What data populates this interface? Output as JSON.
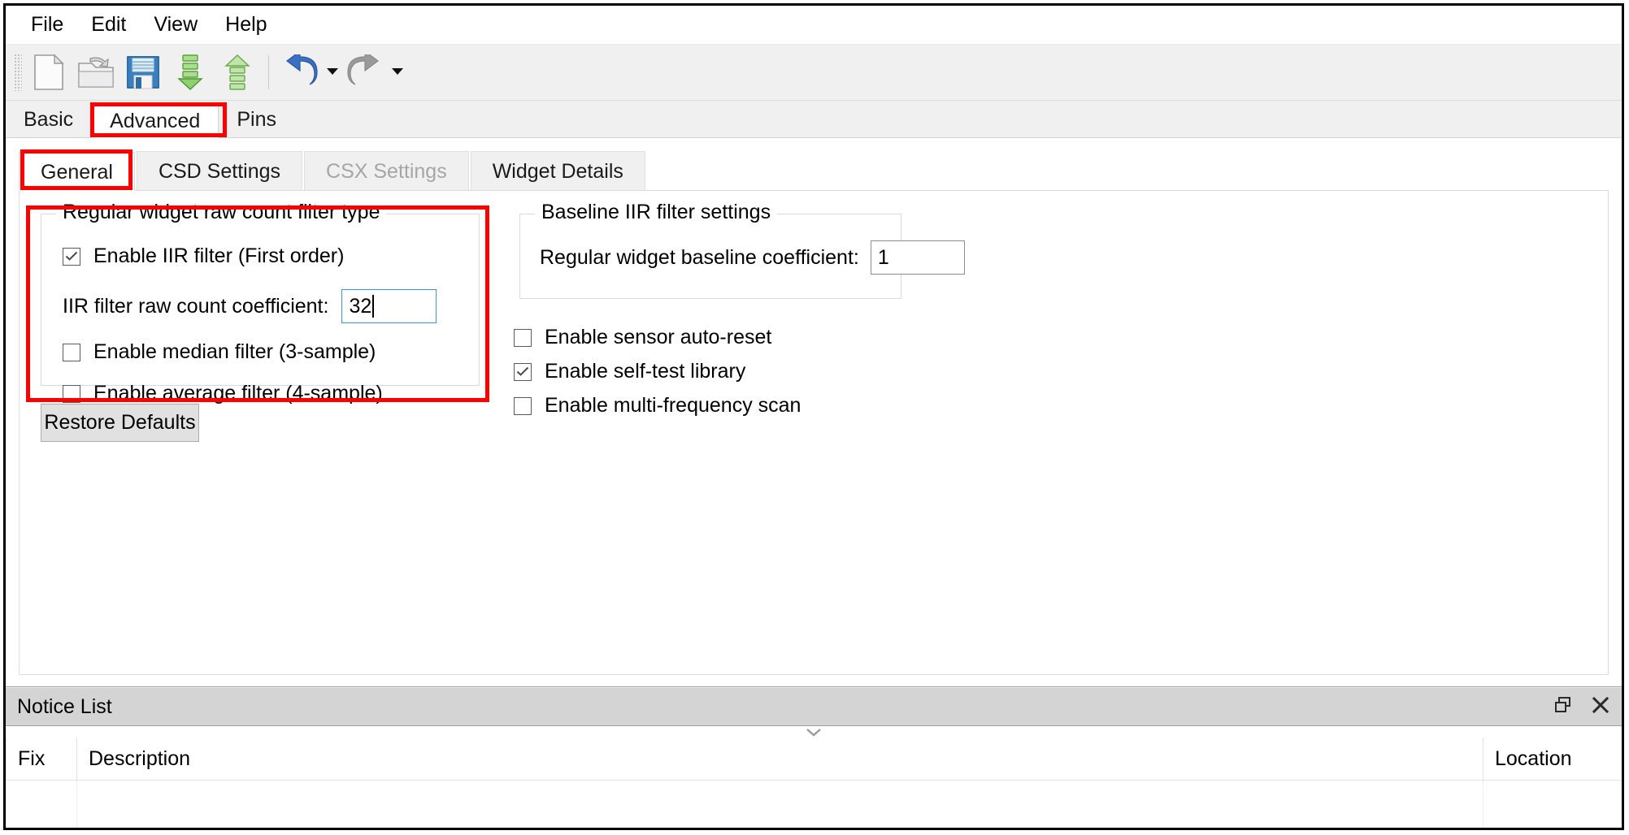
{
  "menu": {
    "items": [
      {
        "label": "File"
      },
      {
        "label": "Edit"
      },
      {
        "label": "View"
      },
      {
        "label": "Help"
      }
    ]
  },
  "toolbar": {
    "buttons": [
      {
        "name": "new-file-icon",
        "tooltip": "New",
        "enabled": true
      },
      {
        "name": "open-folder-icon",
        "tooltip": "Open",
        "enabled": true
      },
      {
        "name": "save-icon",
        "tooltip": "Save",
        "enabled": true
      },
      {
        "name": "download-icon",
        "tooltip": "Import",
        "enabled": true
      },
      {
        "name": "upload-icon",
        "tooltip": "Export",
        "enabled": true
      },
      {
        "name": "undo-icon",
        "tooltip": "Undo",
        "enabled": true
      },
      {
        "name": "redo-icon",
        "tooltip": "Redo",
        "enabled": false
      }
    ]
  },
  "outer_tabs": {
    "items": [
      {
        "label": "Basic",
        "selected": false,
        "highlighted": false
      },
      {
        "label": "Advanced",
        "selected": true,
        "highlighted": true
      },
      {
        "label": "Pins",
        "selected": false,
        "highlighted": false
      }
    ]
  },
  "inner_tabs": {
    "items": [
      {
        "label": "General",
        "selected": true,
        "disabled": false,
        "highlighted": true
      },
      {
        "label": "CSD Settings",
        "selected": false,
        "disabled": false,
        "highlighted": false
      },
      {
        "label": "CSX Settings",
        "selected": false,
        "disabled": true,
        "highlighted": false
      },
      {
        "label": "Widget Details",
        "selected": false,
        "disabled": false,
        "highlighted": false
      }
    ]
  },
  "general_tab": {
    "filter_group": {
      "title": "Regular widget raw count filter type",
      "highlighted": true,
      "iir_checkbox": {
        "label": "Enable IIR filter (First order)",
        "checked": true
      },
      "coefficient_field": {
        "label": "IIR filter raw count coefficient:",
        "value": "32",
        "focused": true
      },
      "median_checkbox": {
        "label": "Enable median filter (3-sample)",
        "checked": false
      },
      "average_checkbox": {
        "label": "Enable average filter (4-sample)",
        "checked": false
      }
    },
    "baseline_group": {
      "title": "Baseline IIR filter settings",
      "coefficient_field": {
        "label": "Regular widget baseline coefficient:",
        "value": "1",
        "focused": false
      }
    },
    "standalone_checkboxes": [
      {
        "label": "Enable sensor auto-reset",
        "checked": false
      },
      {
        "label": "Enable self-test library",
        "checked": true
      },
      {
        "label": "Enable multi-frequency scan",
        "checked": false
      }
    ],
    "restore_defaults_button": {
      "label": "Restore Defaults"
    }
  },
  "notice_list": {
    "title": "Notice List",
    "float_button": "float-icon",
    "close_button": "close-icon",
    "collapse_handle": "chevron-down-icon",
    "columns": [
      "Fix",
      "Description",
      "Location"
    ],
    "rows": []
  },
  "colors": {
    "highlight": "#fe0000",
    "toolbar_bg": "#f0f0f0",
    "dock_header_bg": "#d4d4d4",
    "focus_border": "#3a9ad9",
    "disabled_text": "#a6a6a6"
  }
}
